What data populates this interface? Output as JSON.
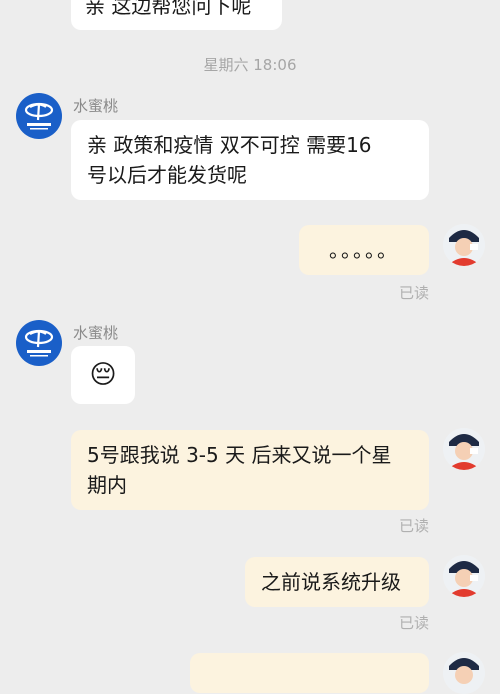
{
  "messages": [
    {
      "text": "亲 这边帮您问下呢"
    },
    {
      "time": "星期六 18:06"
    },
    {
      "sender": "水蜜桃",
      "text_lines": [
        "亲 政策和疫情 双不可控 需要16",
        "号以后才能发货呢"
      ]
    },
    {
      "text": "。。。。。",
      "read": "已读"
    },
    {
      "sender": "水蜜桃",
      "emoji": "😔"
    },
    {
      "text_lines": [
        "5号跟我说 3-5 天 后来又说一个星",
        "期内"
      ],
      "read": "已读"
    },
    {
      "text": "之前说系统升级",
      "read": "已读"
    }
  ],
  "avatars": {
    "contact": "china-telecom-logo-icon",
    "user": "user-photo-avatar"
  },
  "colors": {
    "background": "#ededed",
    "incoming_bubble": "#ffffff",
    "outgoing_bubble": "#fcf3df",
    "telecom_blue": "#1a5fc8"
  }
}
